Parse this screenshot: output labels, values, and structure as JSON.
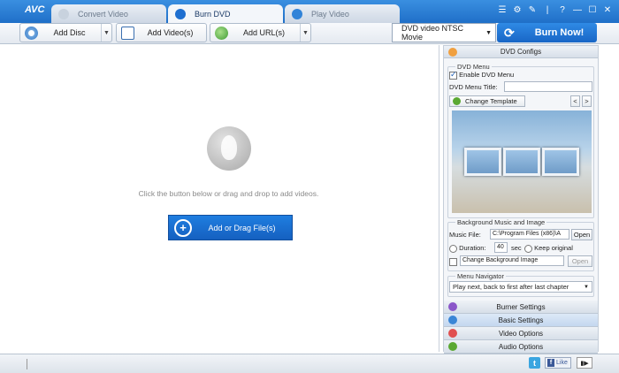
{
  "app": {
    "logo": "AVC"
  },
  "tabs": [
    {
      "label": "Convert Video",
      "state": "inactive"
    },
    {
      "label": "Burn DVD",
      "state": "active"
    },
    {
      "label": "Play Video",
      "state": "inactive"
    }
  ],
  "window_controls": {
    "minimize": "—",
    "maximize": "☐",
    "close": "✕",
    "help": "?"
  },
  "toolbar": {
    "add_disc": "Add Disc",
    "add_videos": "Add Video(s)",
    "add_urls": "Add URL(s)",
    "profile": "DVD video NTSC Movie",
    "burn_now": "Burn Now!"
  },
  "droparea": {
    "hint": "Click the button below or drag and drop to add videos.",
    "add_button": "Add or Drag File(s)"
  },
  "panel": {
    "dvd_configs": "DVD Configs",
    "dvd_menu": {
      "group_label": "DVD Menu",
      "enable_label": "Enable DVD Menu",
      "enable_checked": true,
      "title_label": "DVD Menu Title:",
      "title_value": ""
    },
    "template": {
      "change_label": "Change Template",
      "prev": "<",
      "next": ">"
    },
    "bg": {
      "group_label": "Background Music and Image",
      "music_label": "Music File:",
      "music_value": "C:\\Program Files (x86)\\A",
      "open": "Open",
      "duration_label": "Duration:",
      "duration_value": "40",
      "sec": "sec",
      "keep_original": "Keep original",
      "change_bg": "Change Background Image",
      "open2": "Open"
    },
    "nav": {
      "group_label": "Menu Navigator",
      "selected": "Play next, back to first after last chapter"
    },
    "sections": [
      {
        "label": "Burner Settings",
        "color": "#8a56c9"
      },
      {
        "label": "Basic Settings",
        "color": "#3b86d6"
      },
      {
        "label": "Video Options",
        "color": "#e05050"
      },
      {
        "label": "Audio Options",
        "color": "#5aa832"
      }
    ]
  },
  "statusbar": {
    "twitter": "t",
    "facebook_like": "Like",
    "fb_f": "f"
  },
  "colors": {
    "accent": "#1f6fc8",
    "burn": "#1866c6"
  }
}
